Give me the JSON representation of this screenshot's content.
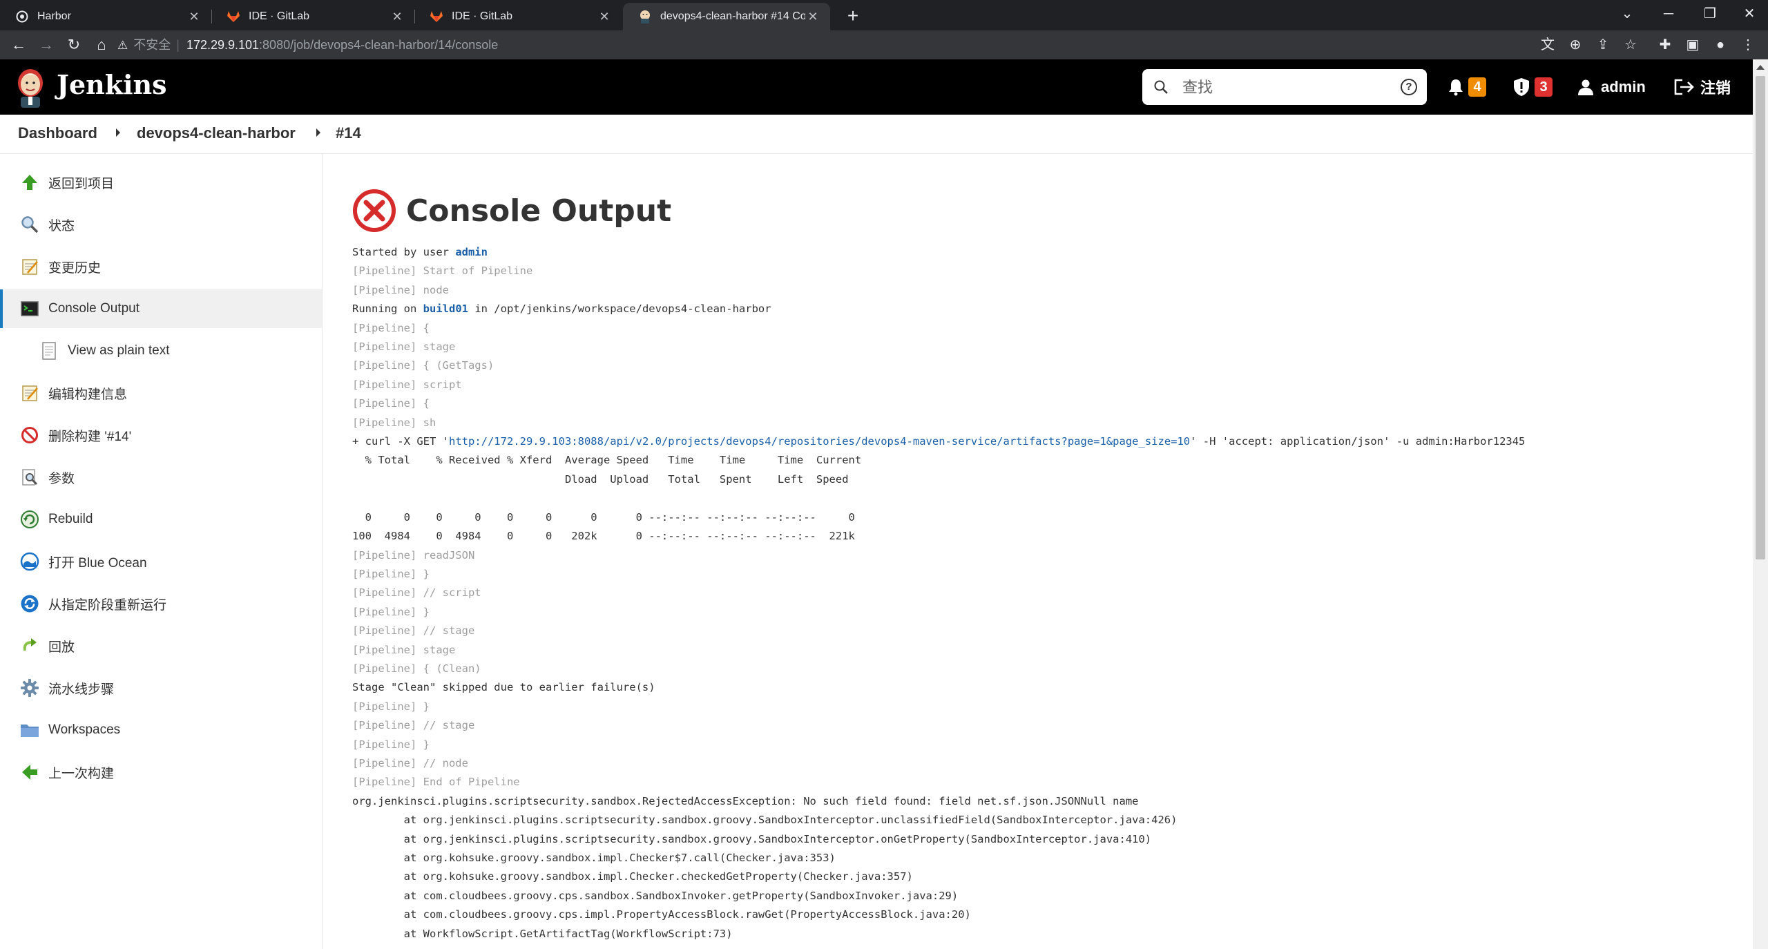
{
  "browser": {
    "tabs": [
      {
        "title": "Harbor",
        "icon": "harbor-icon",
        "active": false
      },
      {
        "title": "IDE · GitLab",
        "icon": "gitlab-icon",
        "active": false
      },
      {
        "title": "IDE · GitLab",
        "icon": "gitlab-icon",
        "active": false
      },
      {
        "title": "devops4-clean-harbor #14 Co",
        "icon": "jenkins-icon",
        "active": true
      }
    ],
    "address": {
      "insecure_label": "不安全",
      "host": "172.29.9.101",
      "path": ":8080/job/devops4-clean-harbor/14/console"
    }
  },
  "header": {
    "brand": "Jenkins",
    "search_placeholder": "查找",
    "notifications_count": "4",
    "security_count": "3",
    "user": "admin",
    "logout": "注销",
    "colors": {
      "notify_badge": "#f08c00",
      "security_badge": "#e03131"
    }
  },
  "breadcrumbs": [
    "Dashboard",
    "devops4-clean-harbor",
    "#14"
  ],
  "sidebar": {
    "items": [
      {
        "label": "返回到项目",
        "icon": "arrow-up-icon"
      },
      {
        "label": "状态",
        "icon": "magnifier-icon"
      },
      {
        "label": "变更历史",
        "icon": "notepad-icon"
      },
      {
        "label": "Console Output",
        "icon": "terminal-icon",
        "active": true
      },
      {
        "label": "View as plain text",
        "icon": "document-icon",
        "sub": true
      },
      {
        "label": "编辑构建信息",
        "icon": "notepad-icon"
      },
      {
        "label": "删除构建 '#14'",
        "icon": "no-entry-icon"
      },
      {
        "label": "参数",
        "icon": "magnifier-doc-icon"
      },
      {
        "label": "Rebuild",
        "icon": "rebuild-icon"
      },
      {
        "label": "打开 Blue Ocean",
        "icon": "blue-ocean-icon"
      },
      {
        "label": "从指定阶段重新运行",
        "icon": "restart-icon"
      },
      {
        "label": "回放",
        "icon": "replay-icon"
      },
      {
        "label": "流水线步骤",
        "icon": "gear-icon"
      },
      {
        "label": "Workspaces",
        "icon": "folder-icon"
      },
      {
        "label": "上一次构建",
        "icon": "arrow-left-icon"
      }
    ]
  },
  "main": {
    "title": "Console Output",
    "console": {
      "started_prefix": "Started by user ",
      "started_user": "admin",
      "running_prefix": "Running on ",
      "running_node": "build01",
      "running_suffix": " in /opt/jenkins/workspace/devops4-clean-harbor",
      "curl_prefix": "+ curl -X GET '",
      "curl_url": "http://172.29.9.103:8088/api/v2.0/projects/devops4/repositories/devops4-maven-service/artifacts?page=1&page_size=10",
      "curl_suffix": "' -H 'accept: application/json' -u admin:Harbor12345",
      "lines_a": [
        "[Pipeline] Start of Pipeline",
        "[Pipeline] node"
      ],
      "lines_b": [
        "[Pipeline] {",
        "[Pipeline] stage",
        "[Pipeline] { (GetTags)",
        "[Pipeline] script",
        "[Pipeline] {",
        "[Pipeline] sh"
      ],
      "lines_c": [
        "  % Total    % Received % Xferd  Average Speed   Time    Time     Time  Current",
        "                                 Dload  Upload   Total   Spent    Left  Speed",
        "",
        "  0     0    0     0    0     0      0      0 --:--:-- --:--:-- --:--:--     0",
        "100  4984    0  4984    0     0   202k      0 --:--:-- --:--:-- --:--:--  221k",
        "[Pipeline] readJSON",
        "[Pipeline] }",
        "[Pipeline] // script",
        "[Pipeline] }",
        "[Pipeline] // stage",
        "[Pipeline] stage",
        "[Pipeline] { (Clean)",
        "Stage \"Clean\" skipped due to earlier failure(s)",
        "[Pipeline] }",
        "[Pipeline] // stage",
        "[Pipeline] }",
        "[Pipeline] // node",
        "[Pipeline] End of Pipeline",
        "org.jenkinsci.plugins.scriptsecurity.sandbox.RejectedAccessException: No such field found: field net.sf.json.JSONNull name",
        "\tat org.jenkinsci.plugins.scriptsecurity.sandbox.groovy.SandboxInterceptor.unclassifiedField(SandboxInterceptor.java:426)",
        "\tat org.jenkinsci.plugins.scriptsecurity.sandbox.groovy.SandboxInterceptor.onGetProperty(SandboxInterceptor.java:410)",
        "\tat org.kohsuke.groovy.sandbox.impl.Checker$7.call(Checker.java:353)",
        "\tat org.kohsuke.groovy.sandbox.impl.Checker.checkedGetProperty(Checker.java:357)",
        "\tat com.cloudbees.groovy.cps.sandbox.SandboxInvoker.getProperty(SandboxInvoker.java:29)",
        "\tat com.cloudbees.groovy.cps.impl.PropertyAccessBlock.rawGet(PropertyAccessBlock.java:20)",
        "\tat WorkflowScript.GetArtifactTag(WorkflowScript:73)"
      ]
    }
  }
}
